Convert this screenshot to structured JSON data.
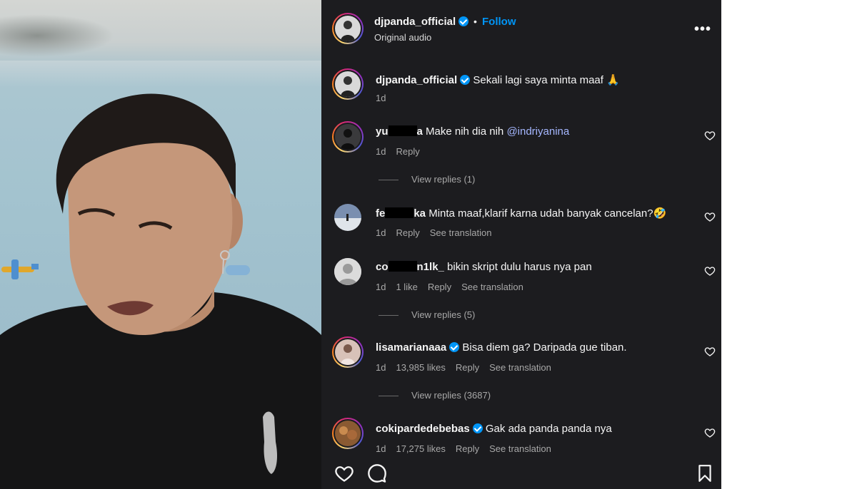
{
  "post": {
    "username": "djpanda_official",
    "follow_label": "Follow",
    "separator": "•",
    "audio_label": "Original audio",
    "more_label": "•••"
  },
  "caption": {
    "username": "djpanda_official",
    "text": "Sekali lagi saya minta maaf 🙏",
    "time": "1d"
  },
  "comments": [
    {
      "user_start": "yu",
      "user_end": "a",
      "text": " Make nih dia nih ",
      "mention": "@indriyanina",
      "time": "1d",
      "reply": "Reply",
      "views": "View replies (1)"
    },
    {
      "user_start": "fe",
      "user_end": "ka",
      "text": " Minta maaf,klarif karna udah banyak cancelan?🤣",
      "time": "1d",
      "reply": "Reply",
      "translate": "See translation"
    },
    {
      "user_start": "co",
      "user_end": "n1lk_",
      "text": " bikin skript dulu harus nya pan",
      "time": "1d",
      "likes": "1 like",
      "reply": "Reply",
      "translate": "See translation",
      "views": "View replies (5)"
    },
    {
      "user": "lisamarianaaa",
      "text": "Bisa diem ga? Daripada gue tiban.",
      "time": "1d",
      "likes": "13,985 likes",
      "reply": "Reply",
      "translate": "See translation",
      "views": "View replies (3687)"
    },
    {
      "user": "cokipardedebebas",
      "text": "Gak ada panda panda nya",
      "time": "1d",
      "likes": "17,275 likes",
      "reply": "Reply",
      "translate": "See translation"
    }
  ],
  "icons": {
    "like": "heart-icon",
    "comment": "comment-icon",
    "save": "bookmark-icon",
    "comment_like": "heart-icon"
  },
  "colors": {
    "panel_bg": "#1c1c1f",
    "accent": "#0095f6",
    "mention": "#a5b7ff",
    "secondary_text": "#a8a8a8"
  }
}
